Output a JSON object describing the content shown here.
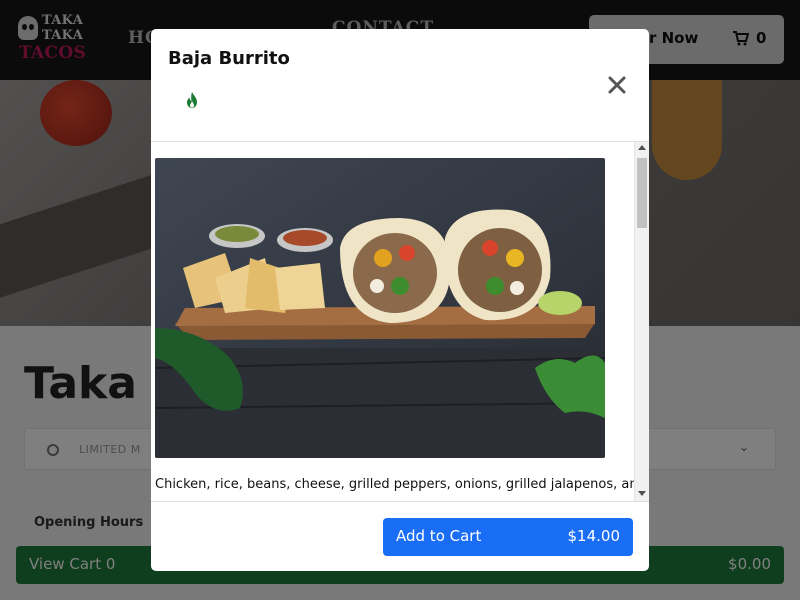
{
  "logo": {
    "line1": "TAKA",
    "line2": "TAKA",
    "line3": "TACOS"
  },
  "nav": {
    "home": "HO",
    "contact": "CONTACT",
    "order_now": "r Now",
    "cart_count": "0"
  },
  "page": {
    "restaurant_title": "Taka T",
    "menu_select": "LIMITED M",
    "opening_hours": "Opening Hours"
  },
  "cart_bar": {
    "label": "View Cart 0",
    "total": "$0.00"
  },
  "modal": {
    "title": "Baja Burrito",
    "spicy_icon": "flame-icon",
    "close_icon": "close-icon",
    "description": "Chicken, rice, beans, cheese, grilled peppers, onions, grilled jalapenos, and",
    "add_to_cart": "Add to Cart",
    "price": "$14.00"
  },
  "colors": {
    "navbar": "#161616",
    "brand_pink": "#c2185b",
    "primary_button": "#1a6ef5",
    "cart_bar": "#1d7c3d",
    "spicy_green": "#1e7b34"
  }
}
